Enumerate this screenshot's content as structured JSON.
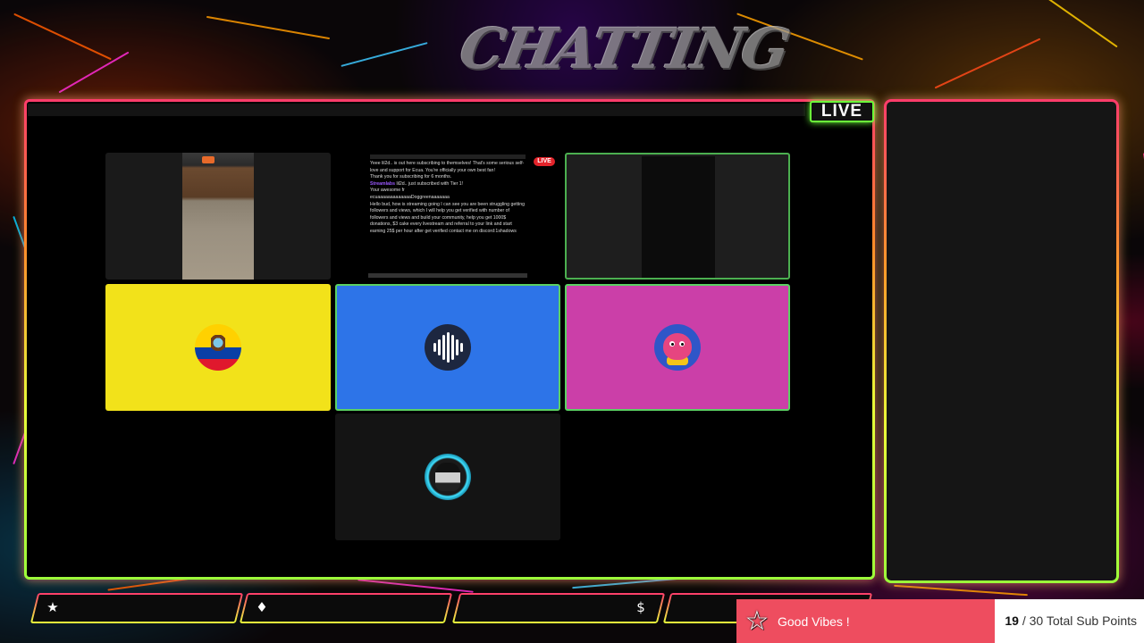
{
  "scene": {
    "title": "CHATTING",
    "live_label": "LIVE"
  },
  "stream_preview": {
    "live_label": "LIVE",
    "chat_lines": [
      {
        "user": "",
        "text": "Yeee lil2d.. is out here subscribing to themselves! That's some serious self-love and support for Ecua. You're officially your own best fan!"
      },
      {
        "user": "",
        "text": "Thank you for subscribing for 6 months."
      },
      {
        "user": "Streamlabs",
        "text": "lil2d.. just subscribed with Tier 1!"
      },
      {
        "user": "",
        "text": "Your awesome fr"
      },
      {
        "user": "",
        "text": "ecuaaaaaaaaaaaaaDoggreenaaaaaaa"
      },
      {
        "user": "",
        "text": "Hello bud, how is streaming going I can see you are been struggling getting followers and views, which I will help you get verified with number of followers and views and build your community, help you get 1000$ donations, $3 cake every livestream and referral to your link and start earning 25$ per hour after get verified contact me on discord:1shadows"
      }
    ]
  },
  "participants": [
    {
      "id": "cam-1",
      "type": "camera"
    },
    {
      "id": "screen-share",
      "type": "screen"
    },
    {
      "id": "cam-2",
      "type": "camera",
      "speaking": true
    },
    {
      "id": "flag-ecuador",
      "type": "avatar",
      "icon": "ecuador-flag-icon",
      "bg": "#f2e21a"
    },
    {
      "id": "waveform",
      "type": "avatar",
      "icon": "waveform-icon",
      "bg": "#2d74e8",
      "speaking": true
    },
    {
      "id": "cartoon-char",
      "type": "avatar",
      "icon": "cartoon-character-icon",
      "bg": "#cb3fa8",
      "speaking": true
    },
    {
      "id": "anime-char",
      "type": "avatar",
      "icon": "anime-character-icon",
      "bg": "#141414"
    }
  ],
  "stat_bar": {
    "slots": [
      {
        "icon": "star-icon",
        "glyph": "★",
        "value": ""
      },
      {
        "icon": "diamond-icon",
        "glyph": "♦",
        "value": ""
      },
      {
        "icon": "dollar-icon",
        "glyph": "$",
        "value": ""
      },
      {
        "icon": "",
        "glyph": "",
        "value": ""
      }
    ]
  },
  "goal": {
    "icon": "star-icon",
    "title": "Good Vibes !",
    "current": "19",
    "separator": " / ",
    "target": "30",
    "label": "Total Sub Points",
    "progress": 0.633,
    "fill_color": "#ee4d5f"
  }
}
